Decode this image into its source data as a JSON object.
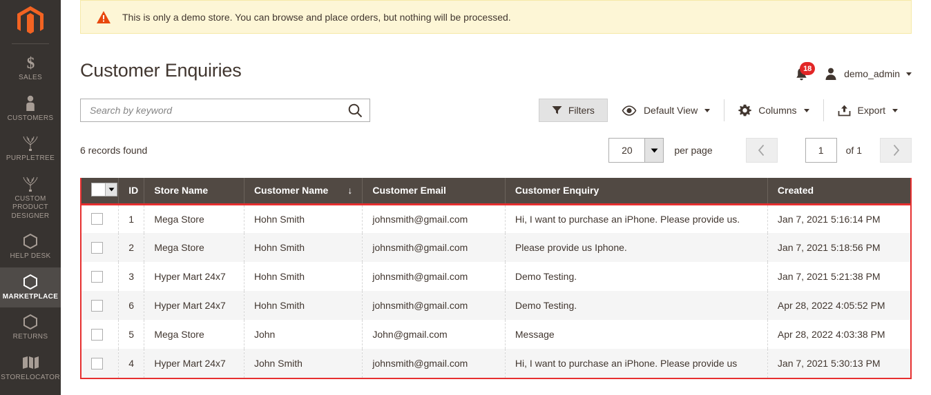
{
  "sidebar": {
    "logo_name": "magento-logo",
    "items": [
      {
        "label": "SALES",
        "icon": "dollar-icon",
        "active": false
      },
      {
        "label": "CUSTOMERS",
        "icon": "person-icon",
        "active": false
      },
      {
        "label": "PURPLETREE",
        "icon": "tree-icon",
        "active": false
      },
      {
        "label": "CUSTOM PRODUCT DESIGNER",
        "icon": "tree-icon",
        "active": false
      },
      {
        "label": "HELP DESK",
        "icon": "hexagon-icon",
        "active": false
      },
      {
        "label": "MARKETPLACE",
        "icon": "hexagon-icon",
        "active": true
      },
      {
        "label": "RETURNS",
        "icon": "hexagon-icon",
        "active": false
      },
      {
        "label": "STORELOCATOR",
        "icon": "map-icon",
        "active": false
      }
    ]
  },
  "notice": {
    "icon": "warning-icon",
    "text": "This is only a demo store. You can browse and place orders, but nothing will be processed."
  },
  "header": {
    "title": "Customer Enquiries",
    "notifications": {
      "icon": "bell-icon",
      "count": "18"
    },
    "user": {
      "icon": "user-avatar-icon",
      "name": "demo_admin",
      "caret": "chevron-down-icon"
    }
  },
  "search": {
    "placeholder": "Search by keyword",
    "value": "",
    "icon": "search-icon"
  },
  "grid_tools": {
    "filters": {
      "label": "Filters",
      "icon": "filter-icon"
    },
    "view": {
      "label": "Default View",
      "icon": "eye-icon",
      "caret": "chevron-down-icon"
    },
    "columns": {
      "label": "Columns",
      "icon": "gear-icon",
      "caret": "chevron-down-icon"
    },
    "export": {
      "label": "Export",
      "icon": "upload-icon",
      "caret": "chevron-down-icon"
    }
  },
  "pager": {
    "records_found": "6 records found",
    "per_page_value": "20",
    "per_page_label": "per page",
    "prev_icon": "chevron-left-icon",
    "next_icon": "chevron-right-icon",
    "page_value": "1",
    "of_label": "of 1"
  },
  "table": {
    "select_all": {
      "icon": "checkbox-dropdown"
    },
    "columns": [
      {
        "label": "ID",
        "sorted": false
      },
      {
        "label": "Store Name",
        "sorted": false
      },
      {
        "label": "Customer Name",
        "sorted": true,
        "sort_icon": "↓"
      },
      {
        "label": "Customer Email",
        "sorted": false
      },
      {
        "label": "Customer Enquiry",
        "sorted": false
      },
      {
        "label": "Created",
        "sorted": false
      }
    ],
    "rows": [
      {
        "id": "1",
        "store_name": "Mega Store",
        "customer_name": "Hohn Smith",
        "customer_email": "johnsmith@gmail.com",
        "customer_enquiry": "Hi, I want to purchase an iPhone. Please provide us.",
        "created": "Jan 7, 2021 5:16:14 PM"
      },
      {
        "id": "2",
        "store_name": "Mega Store",
        "customer_name": "Hohn Smith",
        "customer_email": "johnsmith@gmail.com",
        "customer_enquiry": "Please provide us Iphone.",
        "created": "Jan 7, 2021 5:18:56 PM"
      },
      {
        "id": "3",
        "store_name": "Hyper Mart 24x7",
        "customer_name": "Hohn Smith",
        "customer_email": "johnsmith@gmail.com",
        "customer_enquiry": "Demo Testing.",
        "created": "Jan 7, 2021 5:21:38 PM"
      },
      {
        "id": "6",
        "store_name": "Hyper Mart 24x7",
        "customer_name": "Hohn Smith",
        "customer_email": "johnsmith@gmail.com",
        "customer_enquiry": "Demo Testing.",
        "created": "Apr 28, 2022 4:05:52 PM"
      },
      {
        "id": "5",
        "store_name": "Mega Store",
        "customer_name": "John",
        "customer_email": "John@gmail.com",
        "customer_enquiry": "Message",
        "created": "Apr 28, 2022 4:03:38 PM"
      },
      {
        "id": "4",
        "store_name": "Hyper Mart 24x7",
        "customer_name": "John Smith",
        "customer_email": "johnsmith@gmail.com",
        "customer_enquiry": "Hi, I want to purchase an iPhone. Please provide us",
        "created": "Jan 7, 2021 5:30:13 PM"
      }
    ]
  },
  "colors": {
    "sidebar_bg": "#373330",
    "sidebar_active": "#4f4b48",
    "magento_orange": "#f26322",
    "header_row": "#514943",
    "accent_red": "#e62f2f",
    "notice_bg": "#fdf6d6",
    "badge_red": "#e22626",
    "text": "#41362f"
  }
}
